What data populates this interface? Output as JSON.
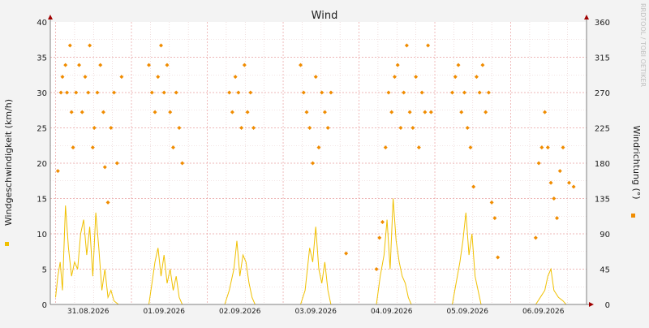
{
  "chart_data": {
    "type": "line",
    "title": "Wind",
    "watermark": "RRDTOOL / TOBI OETIKER",
    "ylabel_left": "Windgeschwindigkeit (km/h)",
    "ylabel_right": "Windrichtung (°)",
    "ylim_left": [
      0,
      40
    ],
    "ylim_right": [
      0,
      360
    ],
    "yticks_left": [
      "0",
      "5",
      "10",
      "15",
      "20",
      "25",
      "30",
      "35",
      "40"
    ],
    "yticks_right": [
      "0",
      "45",
      "90",
      "135",
      "180",
      "225",
      "270",
      "315",
      "360"
    ],
    "x_domain": [
      0,
      7.07
    ],
    "day_starts": [
      0.07,
      1.07,
      2.07,
      3.07,
      4.07,
      5.07,
      6.07
    ],
    "date_labels": [
      {
        "x": 0.5,
        "label": "31.08.2026"
      },
      {
        "x": 1.5,
        "label": "01.09.2026"
      },
      {
        "x": 2.5,
        "label": "02.09.2026"
      },
      {
        "x": 3.5,
        "label": "03.09.2026"
      },
      {
        "x": 4.5,
        "label": "04.09.2026"
      },
      {
        "x": 5.5,
        "label": "05.09.2026"
      },
      {
        "x": 6.5,
        "label": "06.09.2026"
      }
    ],
    "grid": true,
    "colors": {
      "speed": "#f0c000",
      "direction": "#f08c00",
      "major_grid": "#e9a0a0",
      "minor_grid": "#e6c8c8",
      "axis": "#808080",
      "axis_arrow": "#a00000",
      "background": "#f3f3f3",
      "plot_background": "#ffffff",
      "text": "#202020"
    },
    "series": [
      {
        "key": "speed",
        "style": "line",
        "axis": "left",
        "points": [
          [
            0.07,
            1
          ],
          [
            0.1,
            4
          ],
          [
            0.13,
            6
          ],
          [
            0.16,
            2
          ],
          [
            0.2,
            14
          ],
          [
            0.24,
            8
          ],
          [
            0.28,
            4
          ],
          [
            0.32,
            6
          ],
          [
            0.36,
            5
          ],
          [
            0.4,
            10
          ],
          [
            0.44,
            12
          ],
          [
            0.48,
            7
          ],
          [
            0.52,
            11
          ],
          [
            0.56,
            4
          ],
          [
            0.6,
            13
          ],
          [
            0.64,
            8
          ],
          [
            0.68,
            2
          ],
          [
            0.72,
            5
          ],
          [
            0.76,
            1
          ],
          [
            0.8,
            2
          ],
          [
            0.84,
            0.5
          ],
          [
            0.9,
            0
          ],
          [
            1.3,
            0
          ],
          [
            1.34,
            3
          ],
          [
            1.38,
            6
          ],
          [
            1.42,
            8
          ],
          [
            1.46,
            4
          ],
          [
            1.5,
            7
          ],
          [
            1.54,
            3
          ],
          [
            1.58,
            5
          ],
          [
            1.62,
            2
          ],
          [
            1.66,
            4
          ],
          [
            1.7,
            1
          ],
          [
            1.74,
            0
          ],
          [
            2.3,
            0
          ],
          [
            2.36,
            2
          ],
          [
            2.42,
            5
          ],
          [
            2.46,
            9
          ],
          [
            2.5,
            4
          ],
          [
            2.54,
            7
          ],
          [
            2.58,
            6
          ],
          [
            2.62,
            3
          ],
          [
            2.66,
            1
          ],
          [
            2.7,
            0
          ],
          [
            3.3,
            0
          ],
          [
            3.36,
            2
          ],
          [
            3.42,
            8
          ],
          [
            3.46,
            6
          ],
          [
            3.5,
            11
          ],
          [
            3.54,
            5
          ],
          [
            3.58,
            3
          ],
          [
            3.62,
            6
          ],
          [
            3.66,
            2
          ],
          [
            3.7,
            0
          ],
          [
            4.3,
            0
          ],
          [
            4.35,
            4
          ],
          [
            4.4,
            7
          ],
          [
            4.44,
            12
          ],
          [
            4.48,
            5
          ],
          [
            4.52,
            15
          ],
          [
            4.56,
            9
          ],
          [
            4.6,
            6
          ],
          [
            4.64,
            4
          ],
          [
            4.68,
            3
          ],
          [
            4.72,
            1
          ],
          [
            4.76,
            0
          ],
          [
            5.3,
            0
          ],
          [
            5.35,
            3
          ],
          [
            5.4,
            6
          ],
          [
            5.44,
            9
          ],
          [
            5.48,
            13
          ],
          [
            5.52,
            7
          ],
          [
            5.56,
            10
          ],
          [
            5.6,
            4
          ],
          [
            5.64,
            2
          ],
          [
            5.68,
            0
          ],
          [
            6.4,
            0
          ],
          [
            6.46,
            1
          ],
          [
            6.52,
            2
          ],
          [
            6.56,
            4
          ],
          [
            6.6,
            5
          ],
          [
            6.64,
            2
          ],
          [
            6.7,
            1
          ],
          [
            6.76,
            0.5
          ],
          [
            6.8,
            0
          ],
          [
            7.0,
            0
          ]
        ]
      },
      {
        "key": "direction",
        "style": "dots",
        "axis": "right",
        "points": [
          [
            0.1,
            170
          ],
          [
            0.14,
            270
          ],
          [
            0.16,
            290
          ],
          [
            0.2,
            305
          ],
          [
            0.22,
            270
          ],
          [
            0.26,
            330
          ],
          [
            0.28,
            245
          ],
          [
            0.3,
            200
          ],
          [
            0.34,
            270
          ],
          [
            0.38,
            305
          ],
          [
            0.42,
            245
          ],
          [
            0.46,
            290
          ],
          [
            0.5,
            270
          ],
          [
            0.52,
            330
          ],
          [
            0.56,
            200
          ],
          [
            0.58,
            225
          ],
          [
            0.62,
            270
          ],
          [
            0.66,
            305
          ],
          [
            0.7,
            245
          ],
          [
            0.72,
            175
          ],
          [
            0.76,
            130
          ],
          [
            0.8,
            225
          ],
          [
            0.84,
            270
          ],
          [
            0.88,
            180
          ],
          [
            0.94,
            290
          ],
          [
            1.3,
            305
          ],
          [
            1.34,
            270
          ],
          [
            1.38,
            245
          ],
          [
            1.42,
            290
          ],
          [
            1.46,
            330
          ],
          [
            1.5,
            270
          ],
          [
            1.54,
            305
          ],
          [
            1.58,
            245
          ],
          [
            1.62,
            200
          ],
          [
            1.66,
            270
          ],
          [
            1.7,
            225
          ],
          [
            1.74,
            180
          ],
          [
            2.36,
            270
          ],
          [
            2.4,
            245
          ],
          [
            2.44,
            290
          ],
          [
            2.48,
            270
          ],
          [
            2.52,
            225
          ],
          [
            2.56,
            305
          ],
          [
            2.6,
            245
          ],
          [
            2.64,
            270
          ],
          [
            2.68,
            225
          ],
          [
            3.3,
            305
          ],
          [
            3.34,
            270
          ],
          [
            3.38,
            245
          ],
          [
            3.42,
            225
          ],
          [
            3.46,
            180
          ],
          [
            3.5,
            290
          ],
          [
            3.54,
            200
          ],
          [
            3.58,
            270
          ],
          [
            3.62,
            245
          ],
          [
            3.66,
            225
          ],
          [
            3.7,
            270
          ],
          [
            3.9,
            65
          ],
          [
            4.3,
            45
          ],
          [
            4.34,
            85
          ],
          [
            4.38,
            105
          ],
          [
            4.42,
            200
          ],
          [
            4.46,
            270
          ],
          [
            4.5,
            245
          ],
          [
            4.54,
            290
          ],
          [
            4.58,
            305
          ],
          [
            4.62,
            225
          ],
          [
            4.66,
            270
          ],
          [
            4.7,
            330
          ],
          [
            4.74,
            245
          ],
          [
            4.78,
            225
          ],
          [
            4.82,
            290
          ],
          [
            4.86,
            200
          ],
          [
            4.9,
            270
          ],
          [
            4.94,
            245
          ],
          [
            4.98,
            330
          ],
          [
            5.02,
            245
          ],
          [
            5.3,
            270
          ],
          [
            5.34,
            290
          ],
          [
            5.38,
            305
          ],
          [
            5.42,
            245
          ],
          [
            5.46,
            270
          ],
          [
            5.5,
            225
          ],
          [
            5.54,
            200
          ],
          [
            5.58,
            150
          ],
          [
            5.62,
            290
          ],
          [
            5.66,
            270
          ],
          [
            5.7,
            305
          ],
          [
            5.74,
            245
          ],
          [
            5.78,
            270
          ],
          [
            5.82,
            130
          ],
          [
            5.86,
            110
          ],
          [
            5.9,
            60
          ],
          [
            6.4,
            85
          ],
          [
            6.44,
            180
          ],
          [
            6.48,
            200
          ],
          [
            6.52,
            245
          ],
          [
            6.56,
            200
          ],
          [
            6.6,
            155
          ],
          [
            6.64,
            135
          ],
          [
            6.68,
            110
          ],
          [
            6.72,
            170
          ],
          [
            6.76,
            200
          ],
          [
            6.84,
            155
          ],
          [
            6.9,
            150
          ]
        ]
      }
    ]
  }
}
